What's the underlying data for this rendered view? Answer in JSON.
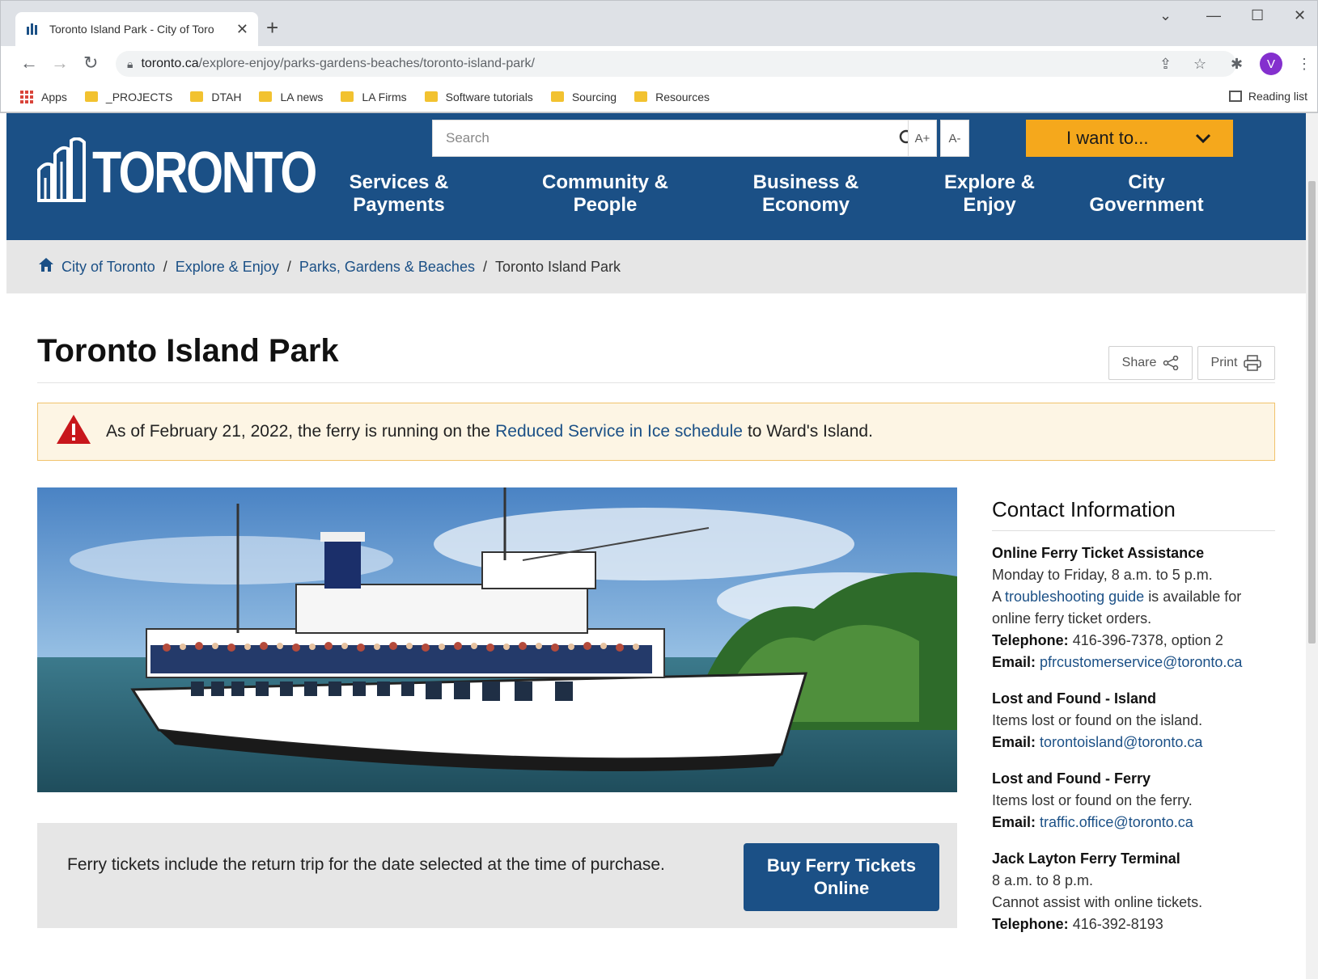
{
  "browser": {
    "tab_title": "Toronto Island Park - City of Toro",
    "url_host": "toronto.ca",
    "url_path": "/explore-enjoy/parks-gardens-beaches/toronto-island-park/",
    "profile_initial": "V",
    "bookmarks": [
      {
        "label": "Apps",
        "type": "apps"
      },
      {
        "label": "_PROJECTS",
        "type": "folder"
      },
      {
        "label": "DTAH",
        "type": "folder"
      },
      {
        "label": "LA news",
        "type": "folder"
      },
      {
        "label": "LA Firms",
        "type": "folder"
      },
      {
        "label": "Software tutorials",
        "type": "folder"
      },
      {
        "label": "Sourcing",
        "type": "folder"
      },
      {
        "label": "Resources",
        "type": "folder"
      }
    ],
    "reading_list": "Reading list"
  },
  "header": {
    "logo_text": "TORONTO",
    "search_placeholder": "Search",
    "font_increase": "A+",
    "font_decrease": "A-",
    "i_want_to": "I want to...",
    "brand_color": "#1b5086",
    "accent_color": "#f5a81c",
    "nav": [
      {
        "line1": "Services &",
        "line2": "Payments"
      },
      {
        "line1": "Community &",
        "line2": "People"
      },
      {
        "line1": "Business &",
        "line2": "Economy"
      },
      {
        "line1": "Explore &",
        "line2": "Enjoy"
      },
      {
        "line1": "City",
        "line2": "Government"
      }
    ]
  },
  "breadcrumb": {
    "items": [
      "City of Toronto",
      "Explore & Enjoy",
      "Parks, Gardens & Beaches"
    ],
    "current": "Toronto Island Park"
  },
  "page": {
    "title": "Toronto Island Park",
    "share": "Share",
    "print": "Print"
  },
  "alert": {
    "prefix": "As of February 21, 2022, the ferry is running on the",
    "link": "Reduced Service in Ice schedule",
    "suffix": "to Ward's Island."
  },
  "ferry_note": {
    "text": "Ferry tickets include the return trip for the date selected at the time of purchase.",
    "button_line1": "Buy Ferry Tickets",
    "button_line2": "Online"
  },
  "contact": {
    "heading": "Contact Information",
    "blocks": [
      {
        "title": "Online Ferry Ticket Assistance",
        "hours": "Monday to Friday, 8 a.m. to 5 p.m.",
        "guide_prefix": "A",
        "guide_link": "troubleshooting guide",
        "guide_suffix": "is available for online ferry ticket orders.",
        "tel_label": "Telephone:",
        "tel": "416-396-7378, option 2",
        "email_label": "Email:",
        "email": "pfrcustomerservice@toronto.ca"
      },
      {
        "title": "Lost and Found - Island",
        "desc": "Items lost or found on the island.",
        "email_label": "Email:",
        "email": "torontoisland@toronto.ca"
      },
      {
        "title": "Lost and Found - Ferry",
        "desc": "Items lost or found on the ferry.",
        "email_label": "Email:",
        "email": "traffic.office@toronto.ca"
      },
      {
        "title": "Jack Layton Ferry Terminal",
        "hours": "8 a.m. to 8 p.m.",
        "desc": "Cannot assist with online tickets.",
        "tel_label": "Telephone:",
        "tel": "416-392-8193"
      }
    ]
  }
}
